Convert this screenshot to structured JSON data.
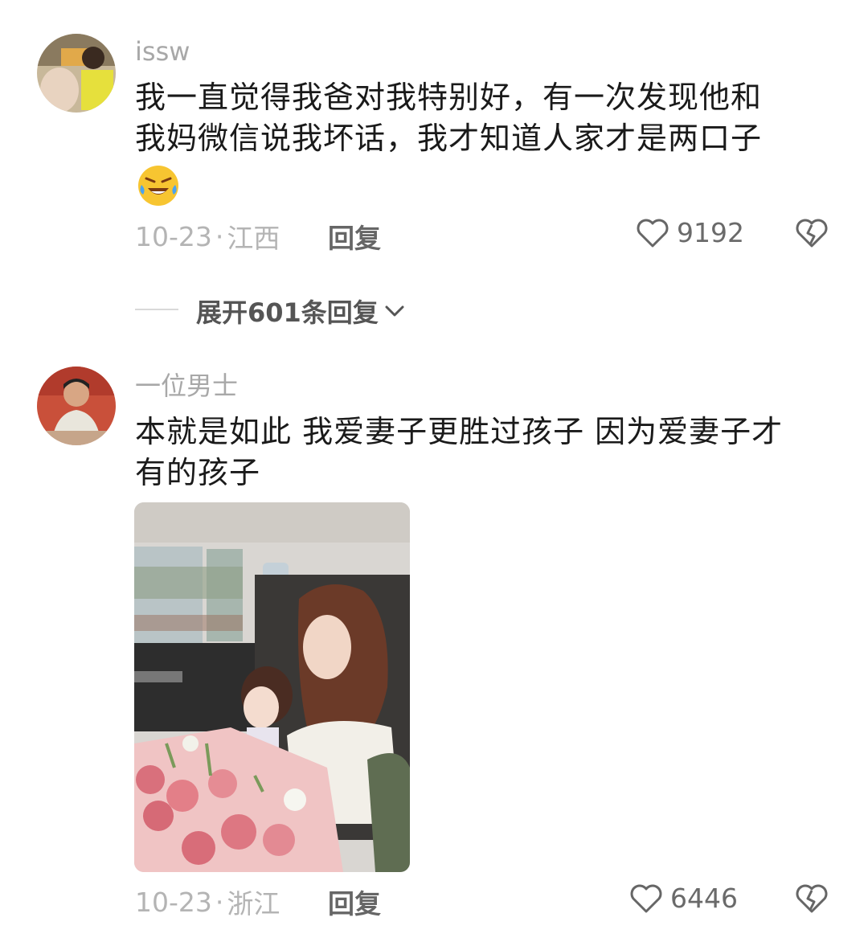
{
  "comment1": {
    "username": "issw",
    "text_line1": "我一直觉得我爸对我特别好，有一次发现他和",
    "text_line2": "我妈微信说我坏话，我才知道人家才是两口子",
    "emoji": "rofl-emoji",
    "date": "10-23",
    "separator": "·",
    "location": "江西",
    "reply_label": "回复",
    "like_count": "9192",
    "icons": {
      "like": "heart-outline-icon",
      "dislike": "broken-heart-icon"
    }
  },
  "expand": {
    "label": "展开601条回复",
    "icon": "chevron-down-icon"
  },
  "comment2": {
    "username": "一位男士",
    "text_line1": "本就是如此 我爱妻子更胜过孩子 因为爱妻子才",
    "text_line2": "有的孩子",
    "image": "photo-woman-child-in-car-with-flowers",
    "date": "10-23",
    "separator": "·",
    "location": "浙江",
    "reply_label": "回复",
    "like_count": "6446",
    "icons": {
      "like": "heart-outline-icon",
      "dislike": "broken-heart-icon"
    }
  },
  "colors": {
    "text": "#1a1a1a",
    "muted": "#b4b4b4",
    "username": "#a8a8a8"
  }
}
